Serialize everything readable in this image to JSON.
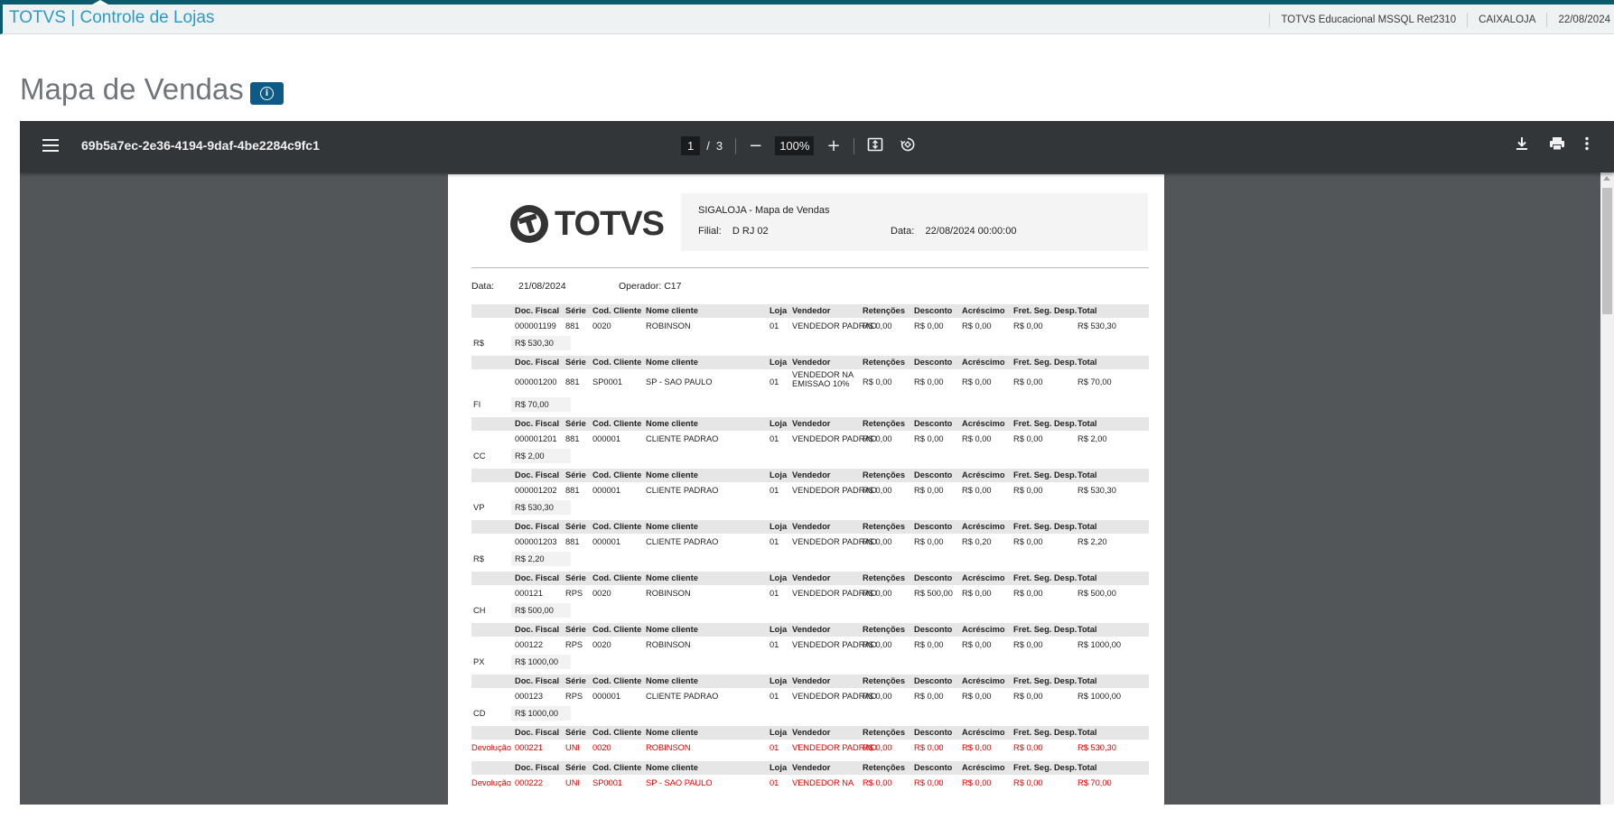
{
  "header": {
    "app_title": "TOTVS | Controle de Lojas",
    "environment": "TOTVS Educacional MSSQL Ret2310",
    "user": "CAIXALOJA",
    "date": "22/08/2024"
  },
  "page": {
    "title": "Mapa de Vendas"
  },
  "viewer": {
    "doc_id": "69b5a7ec-2e36-4194-9daf-4be2284c9fc1",
    "current_page": "1",
    "page_sep": "/",
    "total_pages": "3",
    "zoom": "100%"
  },
  "report": {
    "logo_text": "TOTVS",
    "title": "SIGALOJA - Mapa de Vendas",
    "filial_label": "Filial:",
    "filial_value": "D RJ 02",
    "data_label": "Data:",
    "data_value": "22/08/2024 00:00:00",
    "meta": {
      "data_label": "Data:",
      "data_value": "21/08/2024",
      "operador": "Operador: C17"
    },
    "columns": [
      "Doc. Fiscal",
      "Série",
      "Cod. Cliente",
      "Nome cliente",
      "Loja",
      "Vendedor",
      "Retenções",
      "Desconto",
      "Acréscimo",
      "Fret. Seg. Desp.",
      "Total"
    ],
    "blocks": [
      {
        "row": [
          "000001199",
          "881",
          "0020",
          "ROBINSON",
          "01",
          "VENDEDOR PADRAO",
          "R$ 0,00",
          "R$ 0,00",
          "R$ 0,00",
          "R$ 0,00",
          "R$ 530,30"
        ],
        "sum_label": "R$",
        "sum_value": "R$ 530,30"
      },
      {
        "row": [
          "000001200",
          "881",
          "SP0001",
          "SP - SAO PAULO",
          "01",
          "VENDEDOR NA EMISSAO 10%",
          "R$ 0,00",
          "R$ 0,00",
          "R$ 0,00",
          "R$ 0,00",
          "R$ 70,00"
        ],
        "tall": true,
        "sum_label": "FI",
        "sum_value": "R$ 70,00"
      },
      {
        "row": [
          "000001201",
          "881",
          "000001",
          "CLIENTE PADRAO",
          "01",
          "VENDEDOR PADRAO",
          "R$ 0,00",
          "R$ 0,00",
          "R$ 0,00",
          "R$ 0,00",
          "R$ 2,00"
        ],
        "sum_label": "CC",
        "sum_value": "R$ 2,00"
      },
      {
        "row": [
          "000001202",
          "881",
          "000001",
          "CLIENTE PADRAO",
          "01",
          "VENDEDOR PADRAO",
          "R$ 0,00",
          "R$ 0,00",
          "R$ 0,00",
          "R$ 0,00",
          "R$ 530,30"
        ],
        "sum_label": "VP",
        "sum_value": "R$ 530,30"
      },
      {
        "row": [
          "000001203",
          "881",
          "000001",
          "CLIENTE PADRAO",
          "01",
          "VENDEDOR PADRAO",
          "R$ 0,00",
          "R$ 0,00",
          "R$ 0,20",
          "R$ 0,00",
          "R$ 2,20"
        ],
        "sum_label": "R$",
        "sum_value": "R$ 2,20"
      },
      {
        "row": [
          "000121",
          "RPS",
          "0020",
          "ROBINSON",
          "01",
          "VENDEDOR PADRAO",
          "R$ 0,00",
          "R$ 500,00",
          "R$ 0,00",
          "R$ 0,00",
          "R$ 500,00"
        ],
        "sum_label": "CH",
        "sum_value": "R$ 500,00"
      },
      {
        "row": [
          "000122",
          "RPS",
          "0020",
          "ROBINSON",
          "01",
          "VENDEDOR PADRAO",
          "R$ 0,00",
          "R$ 0,00",
          "R$ 0,00",
          "R$ 0,00",
          "R$ 1000,00"
        ],
        "sum_label": "PX",
        "sum_value": "R$ 1000,00"
      },
      {
        "row": [
          "000123",
          "RPS",
          "000001",
          "CLIENTE PADRAO",
          "01",
          "VENDEDOR PADRAO",
          "R$ 0,00",
          "R$ 0,00",
          "R$ 0,00",
          "R$ 0,00",
          "R$ 1000,00"
        ],
        "sum_label": "CD",
        "sum_value": "R$ 1000,00"
      },
      {
        "row": [
          "000221",
          "UNI",
          "0020",
          "ROBINSON",
          "01",
          "VENDEDOR PADRAO",
          "R$ 0,00",
          "R$ 0,00",
          "R$ 0,00",
          "R$ 0,00",
          "R$ 530,30"
        ],
        "red": true,
        "lead": "Devolução",
        "no_sum": true
      },
      {
        "row": [
          "000222",
          "UNI",
          "SP0001",
          "SP - SAO PAULO",
          "01",
          "VENDEDOR NA",
          "R$ 0,00",
          "R$ 0,00",
          "R$ 0,00",
          "R$ 0,00",
          "R$ 70,00"
        ],
        "red": true,
        "lead": "Devolução",
        "no_sum": true
      }
    ]
  },
  "colors": {
    "brand": "#2a9cc7",
    "top_strip": "#0c5a6e",
    "info_button": "#0e5a87",
    "viewer_toolbar": "#323639",
    "viewer_bg": "#525659",
    "devolucao": "#e60000"
  }
}
